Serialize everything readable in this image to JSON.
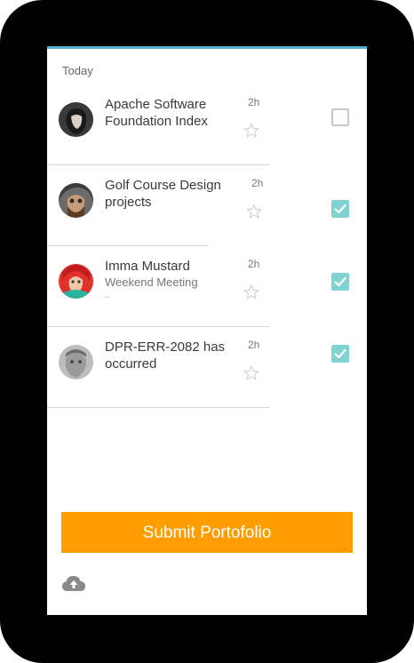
{
  "section_label": "Today",
  "items": [
    {
      "title": "Apache Software Foundation Index",
      "subtitle": "",
      "ellipsis": "",
      "time": "2h",
      "checked": false,
      "avatar": "avatar-dark-hair-woman"
    },
    {
      "title": "Golf Course Design projects",
      "subtitle": "",
      "ellipsis": "",
      "time": "2h",
      "checked": true,
      "avatar": "avatar-bearded-man"
    },
    {
      "title": "Imma Mustard",
      "subtitle": "Weekend Meeting",
      "ellipsis": "..",
      "time": "2h",
      "checked": true,
      "avatar": "avatar-red-hat-woman"
    },
    {
      "title": "DPR-ERR-2082 has occurred",
      "subtitle": "",
      "ellipsis": "",
      "time": "2h",
      "checked": true,
      "avatar": "avatar-grey-man"
    }
  ],
  "submit_label": "Submit Portofolio",
  "icons": {
    "star": "star-outline-icon",
    "upload": "cloud-upload-icon",
    "check": "checkmark-icon"
  },
  "colors": {
    "accent": "#4fb1d6",
    "button": "#fd9d00",
    "checkbox": "#7fd3d3"
  }
}
